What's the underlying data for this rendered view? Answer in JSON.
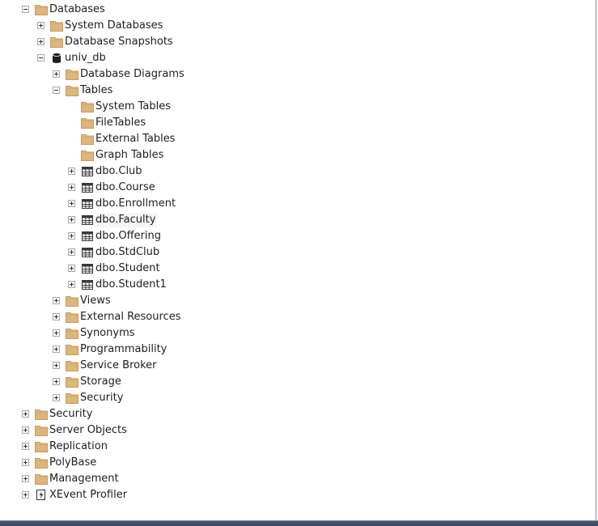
{
  "tree": [
    {
      "id": "databases",
      "label": "Databases",
      "level": 0,
      "expander": "expanded",
      "icon": "folder-icon"
    },
    {
      "id": "system-databases",
      "label": "System Databases",
      "level": 1,
      "expander": "collapsed",
      "icon": "folder-icon"
    },
    {
      "id": "database-snapshots",
      "label": "Database Snapshots",
      "level": 1,
      "expander": "collapsed",
      "icon": "folder-icon"
    },
    {
      "id": "univ-db",
      "label": "univ_db",
      "level": 1,
      "expander": "expanded",
      "icon": "database-icon"
    },
    {
      "id": "database-diagrams",
      "label": "Database Diagrams",
      "level": 2,
      "expander": "collapsed",
      "icon": "folder-icon"
    },
    {
      "id": "tables",
      "label": "Tables",
      "level": 2,
      "expander": "expanded",
      "icon": "folder-icon"
    },
    {
      "id": "system-tables",
      "label": "System Tables",
      "level": 3,
      "expander": "none",
      "icon": "folder-icon"
    },
    {
      "id": "filetables",
      "label": "FileTables",
      "level": 3,
      "expander": "none",
      "icon": "folder-icon"
    },
    {
      "id": "external-tables",
      "label": "External Tables",
      "level": 3,
      "expander": "none",
      "icon": "folder-icon"
    },
    {
      "id": "graph-tables",
      "label": "Graph Tables",
      "level": 3,
      "expander": "none",
      "icon": "folder-icon"
    },
    {
      "id": "dbo-club",
      "label": "dbo.Club",
      "level": 3,
      "expander": "collapsed",
      "icon": "table-icon"
    },
    {
      "id": "dbo-course",
      "label": "dbo.Course",
      "level": 3,
      "expander": "collapsed",
      "icon": "table-icon"
    },
    {
      "id": "dbo-enrollment",
      "label": "dbo.Enrollment",
      "level": 3,
      "expander": "collapsed",
      "icon": "table-icon"
    },
    {
      "id": "dbo-faculty",
      "label": "dbo.Faculty",
      "level": 3,
      "expander": "collapsed",
      "icon": "table-icon",
      "highlight": true
    },
    {
      "id": "dbo-offering",
      "label": "dbo.Offering",
      "level": 3,
      "expander": "collapsed",
      "icon": "table-icon"
    },
    {
      "id": "dbo-stdclub",
      "label": "dbo.StdClub",
      "level": 3,
      "expander": "collapsed",
      "icon": "table-icon"
    },
    {
      "id": "dbo-student",
      "label": "dbo.Student",
      "level": 3,
      "expander": "collapsed",
      "icon": "table-icon"
    },
    {
      "id": "dbo-student1",
      "label": "dbo.Student1",
      "level": 3,
      "expander": "collapsed",
      "icon": "table-icon"
    },
    {
      "id": "views",
      "label": "Views",
      "level": 2,
      "expander": "collapsed",
      "icon": "folder-icon"
    },
    {
      "id": "external-resources",
      "label": "External Resources",
      "level": 2,
      "expander": "collapsed",
      "icon": "folder-icon"
    },
    {
      "id": "synonyms",
      "label": "Synonyms",
      "level": 2,
      "expander": "collapsed",
      "icon": "folder-icon"
    },
    {
      "id": "programmability",
      "label": "Programmability",
      "level": 2,
      "expander": "collapsed",
      "icon": "folder-icon"
    },
    {
      "id": "service-broker",
      "label": "Service Broker",
      "level": 2,
      "expander": "collapsed",
      "icon": "folder-icon"
    },
    {
      "id": "storage",
      "label": "Storage",
      "level": 2,
      "expander": "collapsed",
      "icon": "folder-icon"
    },
    {
      "id": "db-security",
      "label": "Security",
      "level": 2,
      "expander": "collapsed",
      "icon": "folder-icon"
    },
    {
      "id": "security",
      "label": "Security",
      "level": 0,
      "expander": "collapsed",
      "icon": "folder-icon"
    },
    {
      "id": "server-objects",
      "label": "Server Objects",
      "level": 0,
      "expander": "collapsed",
      "icon": "folder-icon"
    },
    {
      "id": "replication",
      "label": "Replication",
      "level": 0,
      "expander": "collapsed",
      "icon": "folder-icon"
    },
    {
      "id": "polybase",
      "label": "PolyBase",
      "level": 0,
      "expander": "collapsed",
      "icon": "folder-icon"
    },
    {
      "id": "management",
      "label": "Management",
      "level": 0,
      "expander": "collapsed",
      "icon": "folder-icon"
    },
    {
      "id": "xevent-profiler",
      "label": "XEvent Profiler",
      "level": 0,
      "expander": "collapsed",
      "icon": "xevent-profiler-icon"
    }
  ],
  "colors": {
    "folder": "#dcb67a",
    "folder_dark": "#c69c5c",
    "database": "#1e1e1e",
    "table_border": "#3a3a3a",
    "expander_border": "#a7a7a7",
    "highlight": "#f5f5f5",
    "bottom_bar": "#3b4466"
  }
}
